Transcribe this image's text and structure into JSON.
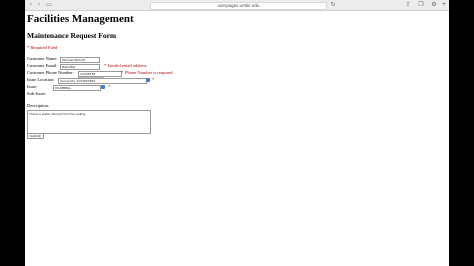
{
  "browser": {
    "url": "userpages.umbc.edu",
    "back_glyph": "‹",
    "forward_glyph": "›",
    "sidebar_glyph": "▭",
    "reload_glyph": "↻",
    "share_glyph": "⇪",
    "tabs_glyph": "❐",
    "settings_glyph": "⚙",
    "add_glyph": "+"
  },
  "page": {
    "title": "Facilities Management",
    "form_title": "Maintenance Request Form",
    "required_note": "* Required Field"
  },
  "form": {
    "name_label": "Customer Name:",
    "name_value": "Michael Bishoff",
    "email_label": "Customer Email:",
    "email_value": "Bishoff@",
    "email_star": "*",
    "email_error": "Invalid email address",
    "phone_label": "Customer Phone Number:",
    "phone_value": "12345678",
    "phone_star": "*",
    "phone_error": "Phone Number is required",
    "phone_suggestion": "1234567890",
    "location_label": "Issue Location:",
    "location_value": "University 1234567890",
    "location_star": "*",
    "issue_label": "Issue:",
    "issue_value": "PLUMBING",
    "issue_star": "*",
    "subissue_label": "Sub-Issue:",
    "description_label": "Description:",
    "description_value": "There is water falling from the ceiling.",
    "submit_label": "Submit"
  },
  "colors": {
    "error": "#b00000",
    "autofill_icon": "#3d7bd6"
  }
}
